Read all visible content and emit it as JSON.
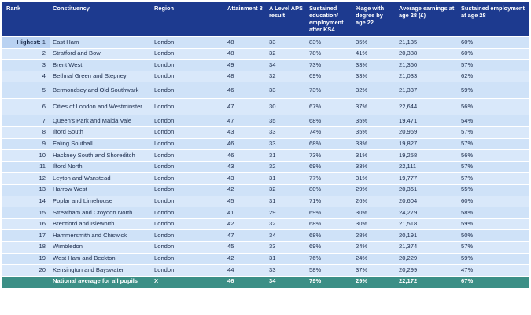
{
  "headers": [
    "Rank",
    "Constituency",
    "Region",
    "Attainment 8",
    "A Level APS result",
    "Sustained education/ employment after KS4",
    "%age with degree by age 22",
    "Average earnings at age 28 (£)",
    "Sustained employment at age 28"
  ],
  "highest_label": "Highest:",
  "rows": [
    {
      "rank": "1",
      "name": "East Ham",
      "region": "London",
      "att8": "48",
      "alevel": "33",
      "sust": "83%",
      "degree": "35%",
      "earn": "21,135",
      "emp": "60%"
    },
    {
      "rank": "2",
      "name": "Stratford and Bow",
      "region": "London",
      "att8": "48",
      "alevel": "32",
      "sust": "78%",
      "degree": "41%",
      "earn": "20,388",
      "emp": "60%"
    },
    {
      "rank": "3",
      "name": "Brent West",
      "region": "London",
      "att8": "49",
      "alevel": "34",
      "sust": "73%",
      "degree": "33%",
      "earn": "21,360",
      "emp": "57%"
    },
    {
      "rank": "4",
      "name": "Bethnal Green and Stepney",
      "region": "London",
      "att8": "48",
      "alevel": "32",
      "sust": "69%",
      "degree": "33%",
      "earn": "21,033",
      "emp": "62%"
    },
    {
      "rank": "5",
      "name": "Bermondsey and Old Southwark",
      "region": "London",
      "att8": "46",
      "alevel": "33",
      "sust": "73%",
      "degree": "32%",
      "earn": "21,337",
      "emp": "59%"
    },
    {
      "rank": "6",
      "name": "Cities of London and Westminster",
      "region": "London",
      "att8": "47",
      "alevel": "30",
      "sust": "67%",
      "degree": "37%",
      "earn": "22,644",
      "emp": "56%"
    },
    {
      "rank": "7",
      "name": "Queen's Park and Maida Vale",
      "region": "London",
      "att8": "47",
      "alevel": "35",
      "sust": "68%",
      "degree": "35%",
      "earn": "19,471",
      "emp": "54%"
    },
    {
      "rank": "8",
      "name": "Ilford South",
      "region": "London",
      "att8": "43",
      "alevel": "33",
      "sust": "74%",
      "degree": "35%",
      "earn": "20,969",
      "emp": "57%"
    },
    {
      "rank": "9",
      "name": "Ealing Southall",
      "region": "London",
      "att8": "46",
      "alevel": "33",
      "sust": "68%",
      "degree": "33%",
      "earn": "19,827",
      "emp": "57%"
    },
    {
      "rank": "10",
      "name": "Hackney South and Shoreditch",
      "region": "London",
      "att8": "46",
      "alevel": "31",
      "sust": "73%",
      "degree": "31%",
      "earn": "19,258",
      "emp": "56%"
    },
    {
      "rank": "11",
      "name": "Ilford North",
      "region": "London",
      "att8": "43",
      "alevel": "32",
      "sust": "69%",
      "degree": "33%",
      "earn": "22,111",
      "emp": "57%"
    },
    {
      "rank": "12",
      "name": "Leyton and Wanstead",
      "region": "London",
      "att8": "43",
      "alevel": "31",
      "sust": "77%",
      "degree": "31%",
      "earn": "19,777",
      "emp": "57%"
    },
    {
      "rank": "13",
      "name": "Harrow West",
      "region": "London",
      "att8": "42",
      "alevel": "32",
      "sust": "80%",
      "degree": "29%",
      "earn": "20,361",
      "emp": "55%"
    },
    {
      "rank": "14",
      "name": "Poplar and Limehouse",
      "region": "London",
      "att8": "45",
      "alevel": "31",
      "sust": "71%",
      "degree": "26%",
      "earn": "20,604",
      "emp": "60%"
    },
    {
      "rank": "15",
      "name": "Streatham and Croydon North",
      "region": "London",
      "att8": "41",
      "alevel": "29",
      "sust": "69%",
      "degree": "30%",
      "earn": "24,279",
      "emp": "58%"
    },
    {
      "rank": "16",
      "name": "Brentford and Isleworth",
      "region": "London",
      "att8": "42",
      "alevel": "32",
      "sust": "68%",
      "degree": "30%",
      "earn": "21,518",
      "emp": "59%"
    },
    {
      "rank": "17",
      "name": "Hammersmith and Chiswick",
      "region": "London",
      "att8": "47",
      "alevel": "34",
      "sust": "68%",
      "degree": "28%",
      "earn": "20,191",
      "emp": "50%"
    },
    {
      "rank": "18",
      "name": "Wimbledon",
      "region": "London",
      "att8": "45",
      "alevel": "33",
      "sust": "69%",
      "degree": "24%",
      "earn": "21,374",
      "emp": "57%"
    },
    {
      "rank": "19",
      "name": "West Ham and Beckton",
      "region": "London",
      "att8": "42",
      "alevel": "31",
      "sust": "76%",
      "degree": "24%",
      "earn": "20,229",
      "emp": "59%"
    },
    {
      "rank": "20",
      "name": "Kensington and Bayswater",
      "region": "London",
      "att8": "44",
      "alevel": "33",
      "sust": "58%",
      "degree": "37%",
      "earn": "20,299",
      "emp": "47%"
    }
  ],
  "national": {
    "label": "National average for all pupils",
    "region": "X",
    "att8": "46",
    "alevel": "34",
    "sust": "79%",
    "degree": "29%",
    "earn": "22,172",
    "emp": "67%"
  }
}
